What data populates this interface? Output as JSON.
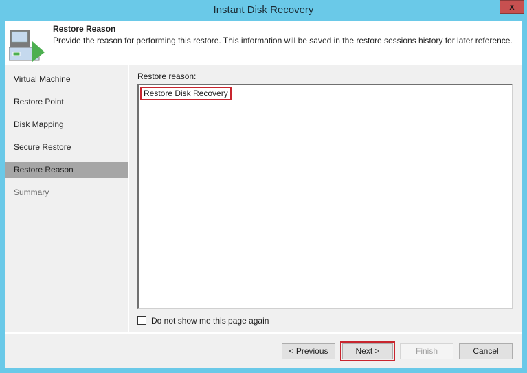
{
  "window": {
    "title": "Instant Disk Recovery",
    "close_label": "x"
  },
  "header": {
    "title": "Restore Reason",
    "description": "Provide the reason for performing this restore. This information will be saved in the restore sessions history for later reference.",
    "icon": "restore-wizard-icon"
  },
  "sidebar": {
    "items": [
      {
        "label": "Virtual Machine",
        "state": "normal"
      },
      {
        "label": "Restore Point",
        "state": "normal"
      },
      {
        "label": "Disk Mapping",
        "state": "normal"
      },
      {
        "label": "Secure Restore",
        "state": "normal"
      },
      {
        "label": "Restore Reason",
        "state": "active"
      },
      {
        "label": "Summary",
        "state": "disabled"
      }
    ]
  },
  "content": {
    "field_label": "Restore reason:",
    "field_value": "Restore Disk Recovery",
    "checkbox_label": "Do not show me this page again",
    "checkbox_checked": false
  },
  "buttons": {
    "previous": "< Previous",
    "next": "Next >",
    "finish": "Finish",
    "cancel": "Cancel"
  },
  "colors": {
    "frame": "#6ac9e8",
    "close": "#c75050",
    "highlight": "#c8252e",
    "active_nav": "#a6a6a6"
  }
}
